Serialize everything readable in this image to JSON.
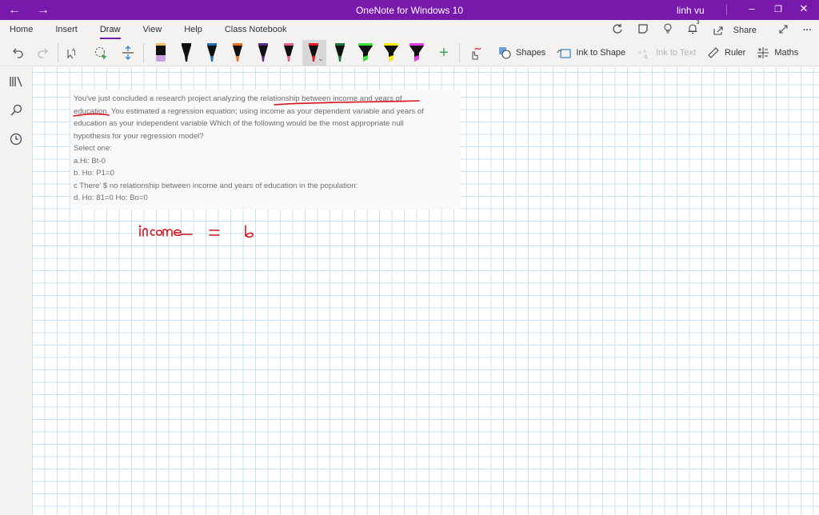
{
  "titlebar": {
    "title": "OneNote for Windows 10",
    "user": "linh vu",
    "back_icon": "←",
    "forward_icon": "→",
    "minimize": "–",
    "restore": "❐",
    "close": "✕"
  },
  "menu": {
    "tabs": [
      "Home",
      "Insert",
      "Draw",
      "View",
      "Help",
      "Class Notebook"
    ],
    "active_tab": "Draw",
    "share_label": "Share",
    "notification_count": "3",
    "more": "···"
  },
  "toolbar": {
    "pens": [
      {
        "type": "eraser",
        "color": "#f0c060",
        "tip": "#c8a0e0"
      },
      {
        "type": "pen",
        "color": "#111111"
      },
      {
        "type": "pen",
        "color": "#1f6fb2"
      },
      {
        "type": "pen",
        "color": "#e8731a"
      },
      {
        "type": "pen",
        "color": "#5b2d90"
      },
      {
        "type": "pen",
        "color": "#e8608a"
      },
      {
        "type": "pen",
        "color": "#e01a24",
        "selected": true
      },
      {
        "type": "pen",
        "color": "#1c7a3c"
      },
      {
        "type": "highlighter",
        "color": "#3ee03a"
      },
      {
        "type": "highlighter",
        "color": "#f5ea1a"
      },
      {
        "type": "highlighter",
        "color": "#e040e8"
      }
    ],
    "shapes_label": "Shapes",
    "ink_to_shape_label": "Ink to Shape",
    "ink_to_text_label": "Ink to Text",
    "ruler_label": "Ruler",
    "maths_label": "Maths"
  },
  "page": {
    "question_lines": [
      "You've just concluded a research project analyzing the relationship between income and years of",
      "education. You estimated a regression equation; using income as your dependent variable and years of",
      "education as your independent variable Which of the following would be the most appropriate null",
      "hypothesis for your regression model?",
      "Select one:",
      "a.Hi: Bt-0",
      "b. Ho: P1=0",
      "c There' $ no relationship between income and years of education in the population:",
      "d. Ho: 81=0 Ho: Bo=0"
    ],
    "ink_text": "income = b",
    "ink_color": "#d9141e"
  }
}
